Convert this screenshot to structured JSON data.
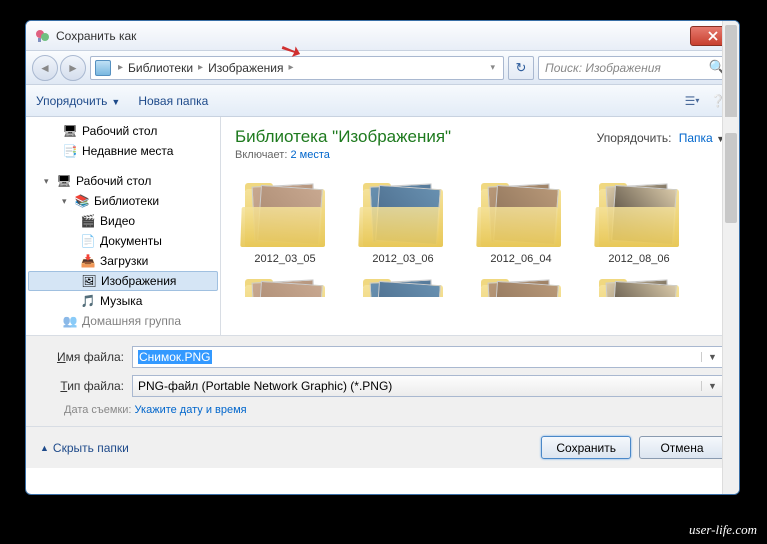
{
  "window": {
    "title": "Сохранить как"
  },
  "breadcrumb": {
    "items": [
      "Библиотеки",
      "Изображения"
    ]
  },
  "search": {
    "placeholder": "Поиск: Изображения"
  },
  "toolbar": {
    "organize": "Упорядочить",
    "new_folder": "Новая папка"
  },
  "sidebar": {
    "favorites": [
      {
        "label": "Рабочий стол",
        "icon": "desktop"
      },
      {
        "label": "Недавние места",
        "icon": "recent"
      }
    ],
    "desktop_root": "Рабочий стол",
    "libraries": "Библиотеки",
    "lib_items": [
      {
        "label": "Видео",
        "icon": "video"
      },
      {
        "label": "Документы",
        "icon": "doc"
      },
      {
        "label": "Загрузки",
        "icon": "download"
      },
      {
        "label": "Изображения",
        "icon": "image",
        "selected": true
      },
      {
        "label": "Музыка",
        "icon": "music"
      }
    ],
    "homegroup": "Домашняя группа"
  },
  "content": {
    "lib_title": "Библиотека \"Изображения\"",
    "includes_label": "Включает:",
    "includes_link": "2 места",
    "sort_label": "Упорядочить:",
    "sort_value": "Папка",
    "folders": [
      {
        "name": "2012_03_05",
        "c1": "#c8a890",
        "c2": "#a88870"
      },
      {
        "name": "2012_03_06",
        "c1": "#6890b0",
        "c2": "#486888"
      },
      {
        "name": "2012_06_04",
        "c1": "#b89878",
        "c2": "#8a7058"
      },
      {
        "name": "2012_08_06",
        "c1": "#d8c8a8",
        "c2": "#403830"
      }
    ]
  },
  "fields": {
    "filename_label": "Имя файла:",
    "filename_value": "Снимок.PNG",
    "filetype_label": "Тип файла:",
    "filetype_value": "PNG-файл (Portable Network Graphic) (*.PNG)",
    "date_label": "Дата съемки:",
    "date_link": "Укажите дату и время"
  },
  "footer": {
    "hide_folders": "Скрыть папки",
    "save": "Сохранить",
    "cancel": "Отмена"
  },
  "watermark": "user-life.com"
}
